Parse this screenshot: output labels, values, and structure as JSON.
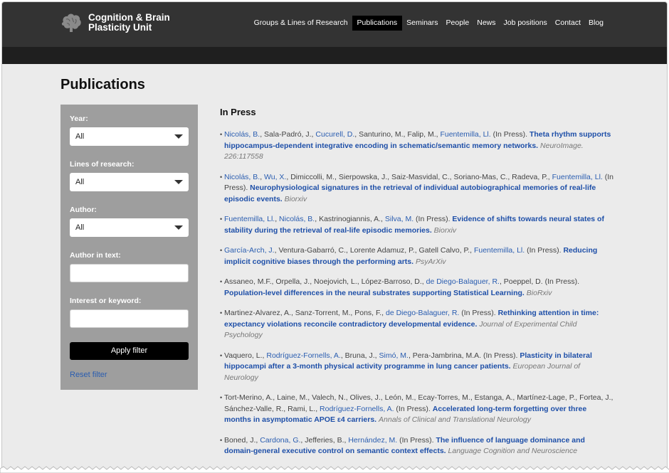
{
  "site": {
    "title_line1": "Cognition & Brain",
    "title_line2": "Plasticity Unit"
  },
  "nav": [
    {
      "label": "Groups & Lines of Research",
      "active": false
    },
    {
      "label": "Publications",
      "active": true
    },
    {
      "label": "Seminars",
      "active": false
    },
    {
      "label": "People",
      "active": false
    },
    {
      "label": "News",
      "active": false
    },
    {
      "label": "Job positions",
      "active": false
    },
    {
      "label": "Contact",
      "active": false
    },
    {
      "label": "Blog",
      "active": false
    }
  ],
  "page_title": "Publications",
  "filters": {
    "year_label": "Year:",
    "year_value": "All",
    "lines_label": "Lines of research:",
    "lines_value": "All",
    "author_label": "Author:",
    "author_value": "All",
    "author_text_label": "Author in text:",
    "keyword_label": "Interest or keyword:",
    "apply_label": "Apply filter",
    "reset_label": "Reset filter"
  },
  "section_title": "In Press",
  "colors": {
    "header": "#333333",
    "link": "#2a5db0",
    "sidebar": "#9e9e9e"
  },
  "publications": [
    {
      "authors": [
        [
          "Nicolás, B.",
          true
        ],
        [
          ", Sala-Padró, J., ",
          false
        ],
        [
          "Cucurell, D.",
          true
        ],
        [
          ", Santurino, M., Falip, M., ",
          false
        ],
        [
          "Fuentemilla, Ll.",
          true
        ],
        [
          " (In Press). ",
          false
        ]
      ],
      "title": "Theta rhythm supports hippocampus-dependent integrative encoding in schematic/semantic memory networks.",
      "journal": "NeuroImage. 226:117558"
    },
    {
      "authors": [
        [
          "Nicolás, B.",
          true
        ],
        [
          ", ",
          false
        ],
        [
          "Wu, X.",
          true
        ],
        [
          ", Dimiccolli, M., Sierpowska, J., Saiz-Masvidal, C., Soriano-Mas, C., Radeva, P., ",
          false
        ],
        [
          "Fuentemilla, Ll.",
          true
        ],
        [
          " (In Press). ",
          false
        ]
      ],
      "title": "Neurophysiological signatures in the retrieval of individual autobiographical memories of real-life episodic events.",
      "journal": "Biorxiv"
    },
    {
      "authors": [
        [
          "Fuentemilla, Ll.",
          true
        ],
        [
          ", ",
          false
        ],
        [
          "Nicolás, B.",
          true
        ],
        [
          ", Kastrinogiannis, A., ",
          false
        ],
        [
          "Silva, M.",
          true
        ],
        [
          " (In Press). ",
          false
        ]
      ],
      "title": "Evidence of shifts towards neural states of stability during the retrieval of real-life episodic memories.",
      "journal": "Biorxiv"
    },
    {
      "authors": [
        [
          "García-Arch, J.",
          true
        ],
        [
          ", Ventura-Gabarró, C., Lorente Adamuz, P., Gatell Calvo, P., ",
          false
        ],
        [
          "Fuentemilla, Ll.",
          true
        ],
        [
          " (In Press). ",
          false
        ]
      ],
      "title": "Reducing implicit cognitive biases through the performing arts.",
      "journal": "PsyArXiv"
    },
    {
      "authors": [
        [
          "Assaneo, M.F., Orpella, J., Noejovich, L., López-Barroso, D., ",
          false
        ],
        [
          "de Diego-Balaguer, R.",
          true
        ],
        [
          ", Poeppel, D. (In Press). ",
          false
        ]
      ],
      "title": "Population-level differences in the neural substrates supporting Statistical Learning.",
      "journal": "BioRxiv"
    },
    {
      "authors": [
        [
          "Martinez-Alvarez, A., Sanz-Torrent, M., Pons, F., ",
          false
        ],
        [
          "de Diego-Balaguer, R.",
          true
        ],
        [
          " (In Press). ",
          false
        ]
      ],
      "title": "Rethinking attention in time: expectancy violations reconcile contradictory developmental evidence.",
      "journal": "Journal of Experimental Child Psychology"
    },
    {
      "authors": [
        [
          "Vaquero, L., ",
          false
        ],
        [
          "Rodríguez-Fornells, A.",
          true
        ],
        [
          ", Bruna, J., ",
          false
        ],
        [
          "Simó, M.",
          true
        ],
        [
          ", Pera-Jambrina, M.A. (In Press). ",
          false
        ]
      ],
      "title": "Plasticity in bilateral hippocampi after a 3-month physical activity programme in lung cancer patients.",
      "journal": "European Journal of Neurology"
    },
    {
      "authors": [
        [
          "Tort-Merino, A., Laine, M., Valech, N., Olives, J., León, M., Ecay-Torres, M., Estanga, A., Martínez-Lage, P., Fortea, J., Sánchez-Valle, R., Rami, L., ",
          false
        ],
        [
          "Rodríguez-Fornells, A.",
          true
        ],
        [
          " (In Press). ",
          false
        ]
      ],
      "title": "Accelerated long-term forgetting over three months in asymptomatic APOE ε4 carriers.",
      "journal": "Annals of Clinical and Translational Neurology"
    },
    {
      "authors": [
        [
          "Boned, J., ",
          false
        ],
        [
          "Cardona, G.",
          true
        ],
        [
          ", Jefferies, B., ",
          false
        ],
        [
          "Hernández, M.",
          true
        ],
        [
          " (In Press). ",
          false
        ]
      ],
      "title": "The influence of language dominance and domain-general executive control on semantic context effects.",
      "journal": "Language Cognition and Neuroscience"
    }
  ]
}
